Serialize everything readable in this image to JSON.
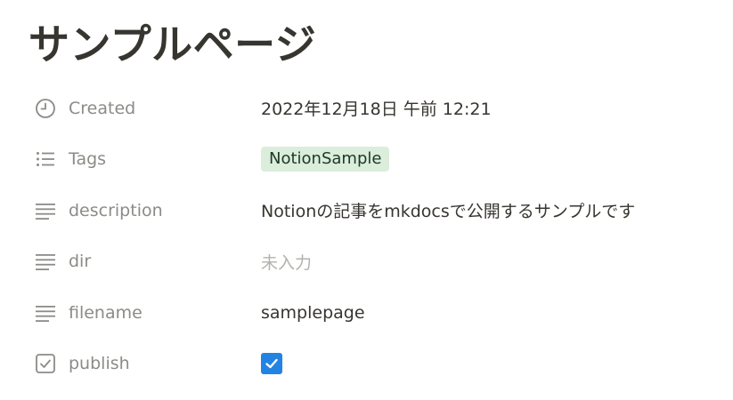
{
  "page": {
    "title": "サンプルページ"
  },
  "properties": [
    {
      "name": "Created",
      "icon": "clock-icon",
      "value": "2022年12月18日 午前 12:21"
    },
    {
      "name": "Tags",
      "icon": "list-icon",
      "value": "NotionSample",
      "tag_color": "#dbeddb"
    },
    {
      "name": "description",
      "icon": "text-icon",
      "value": "Notionの記事をmkdocsで公開するサンプルです"
    },
    {
      "name": "dir",
      "icon": "text-icon",
      "value": "未入力"
    },
    {
      "name": "filename",
      "icon": "text-icon",
      "value": "samplepage"
    },
    {
      "name": "publish",
      "icon": "checkbox-icon",
      "checked": true,
      "accent": "#2383e2"
    }
  ]
}
